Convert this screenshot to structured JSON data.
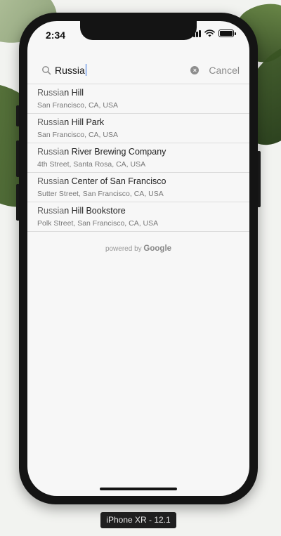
{
  "status_bar": {
    "time": "2:34"
  },
  "search": {
    "query": "Russia",
    "cancel_label": "Cancel"
  },
  "results": [
    {
      "match": "Russia",
      "rest": "n Hill",
      "subtitle": "San Francisco, CA, USA"
    },
    {
      "match": "Russia",
      "rest": "n Hill Park",
      "subtitle": "San Francisco, CA, USA"
    },
    {
      "match": "Russia",
      "rest": "n River Brewing Company",
      "subtitle": "4th Street, Santa Rosa, CA, USA"
    },
    {
      "match": "Russia",
      "rest": "n Center of San Francisco",
      "subtitle": "Sutter Street, San Francisco, CA, USA"
    },
    {
      "match": "Russia",
      "rest": "n Hill Bookstore",
      "subtitle": "Polk Street, San Francisco, CA, USA"
    }
  ],
  "attribution": {
    "prefix": "powered by",
    "brand": "Google"
  },
  "simulator_label": "iPhone XR - 12.1",
  "icons": {
    "search": "magnifier-icon",
    "clear": "clear-circle-icon",
    "wifi": "wifi-icon",
    "battery": "battery-icon",
    "signal": "cellular-signal-icon"
  }
}
